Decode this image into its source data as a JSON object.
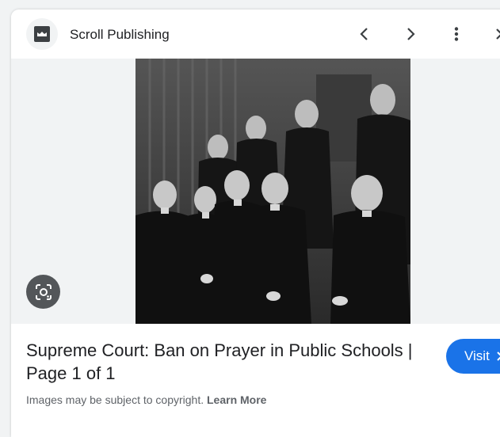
{
  "header": {
    "site_name": "Scroll Publishing",
    "icons": {
      "favicon": "scroll-publishing-logo-icon",
      "back": "chevron-left-icon",
      "forward": "chevron-right-icon",
      "more": "more-vert-icon",
      "close": "close-icon"
    }
  },
  "image": {
    "lens_icon": "google-lens-icon",
    "description": "black-and-white photograph"
  },
  "result": {
    "title": "Supreme Court: Ban on Prayer in Public Schools | Page 1 of 1",
    "visit_label": "Visit",
    "visit_icon": "chevron-right-icon"
  },
  "footer": {
    "copyright_text": "Images may be subject to copyright.",
    "learn_more_label": "Learn More"
  },
  "colors": {
    "accent": "#1a73e8",
    "panel_bg": "#ffffff",
    "page_bg": "#f1f3f4",
    "secondary_text": "#5f6368"
  }
}
